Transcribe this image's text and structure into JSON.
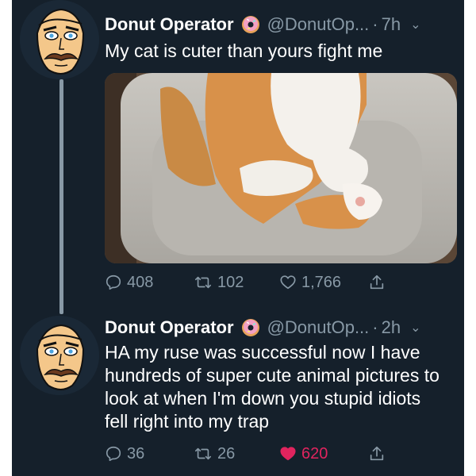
{
  "tweets": [
    {
      "display_name": "Donut Operator",
      "handle": "@DonutOp...",
      "separator": "·",
      "time": "7h",
      "text": "My cat is cuter than yours fight me",
      "has_media": true,
      "media_description": "photo",
      "replies": "408",
      "retweets": "102",
      "likes": "1,766",
      "liked": false
    },
    {
      "display_name": "Donut Operator",
      "handle": "@DonutOp...",
      "separator": "·",
      "time": "2h",
      "text": "HA my ruse was successful now I have hundreds of super cute animal pictures to look at when I'm down you stupid idiots fell right into my trap",
      "has_media": false,
      "replies": "36",
      "retweets": "26",
      "likes": "620",
      "liked": true
    }
  ],
  "colors": {
    "background": "#15202b",
    "primary_text": "#ffffff",
    "secondary_text": "#8899a6",
    "like_active": "#e0245e"
  }
}
